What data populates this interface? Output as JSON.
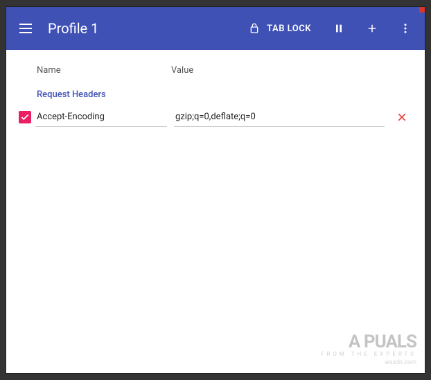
{
  "header": {
    "title": "Profile 1",
    "tab_lock_label": "TAB LOCK"
  },
  "columns": {
    "name": "Name",
    "value": "Value"
  },
  "section_label": "Request Headers",
  "rows": [
    {
      "enabled": true,
      "name": "Accept-Encoding",
      "value": "gzip;q=0,deflate;q=0"
    }
  ],
  "watermark": {
    "brand": "A PUALS",
    "tagline": "FROM THE EXPERTS",
    "site": "wsxdn.com"
  }
}
